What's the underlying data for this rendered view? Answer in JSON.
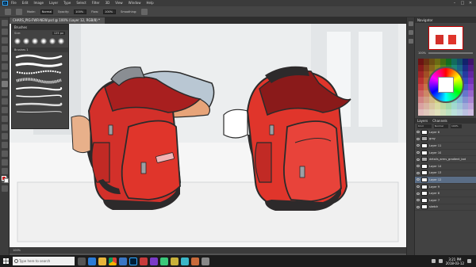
{
  "menubar": {
    "logo": "Ps",
    "items": [
      "File",
      "Edit",
      "Image",
      "Layer",
      "Type",
      "Select",
      "Filter",
      "3D",
      "View",
      "Window",
      "Help"
    ],
    "controls": [
      "–",
      "□",
      "✕"
    ]
  },
  "options": {
    "mode_label": "Mode:",
    "mode_value": "Normal",
    "opacity_label": "Opacity:",
    "opacity_value": "100%",
    "flow_label": "Flow:",
    "flow_value": "100%",
    "smoothing_label": "Smoothing:"
  },
  "document": {
    "tab_title": "CHARS_PIG-FWR-NEW.psd @ 100% (Layer 12, RGB/8) *",
    "status": "100%"
  },
  "brushes_panel": {
    "title": "Brushes",
    "size_label": "Size:",
    "size_value": "125 px",
    "folder_label": "Brushes 1"
  },
  "navigator": {
    "title": "Navigator",
    "zoom": "100%"
  },
  "layers_panel": {
    "tabs": [
      "Layers",
      "Channels"
    ],
    "filter_kind": "Kind",
    "blend_mode": "Normal",
    "opacity": "100%",
    "rows": [
      {
        "name": "Layer 6",
        "selected": false
      },
      {
        "name": "gray",
        "selected": false
      },
      {
        "name": "Layer 11",
        "selected": false
      },
      {
        "name": "Layer 10",
        "selected": false
      },
      {
        "name": "details_arms_gradient_bot",
        "selected": false
      },
      {
        "name": "Layer 14",
        "selected": false
      },
      {
        "name": "Layer 13",
        "selected": false
      },
      {
        "name": "Layer 12",
        "selected": true
      },
      {
        "name": "Layer 9",
        "selected": false
      },
      {
        "name": "Layer 8",
        "selected": false
      },
      {
        "name": "Layer 7",
        "selected": false
      },
      {
        "name": "sketch",
        "selected": false
      }
    ]
  },
  "taskbar": {
    "search_placeholder": "Type here to search",
    "time": "3:21 PM",
    "date": "2018-03-12"
  },
  "colors": {
    "bag_red": "#e0352b",
    "bag_dark": "#2d2a2b",
    "selection": "#5a6d86"
  }
}
